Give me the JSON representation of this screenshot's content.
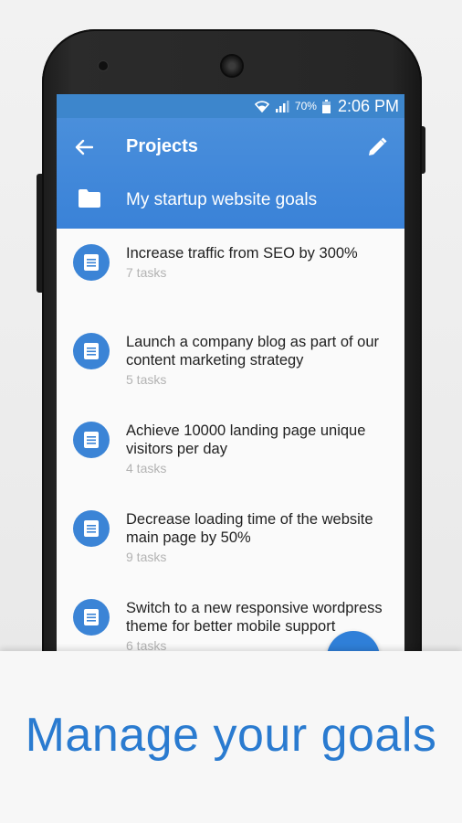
{
  "status_bar": {
    "battery": "70%",
    "time": "2:06 PM",
    "icons": [
      "wifi-icon",
      "signal-icon",
      "battery-icon"
    ]
  },
  "app_bar": {
    "title": "Projects",
    "subtitle": "My startup website goals",
    "icons": [
      "back-arrow-icon",
      "edit-pencil-icon",
      "folder-icon"
    ],
    "color": "#3a82d8"
  },
  "goals": [
    {
      "name": "Increase traffic from SEO by 300%",
      "tasks": "7 tasks"
    },
    {
      "name": "Launch a company blog as part of our content marketing strategy",
      "tasks": "5 tasks"
    },
    {
      "name": "Achieve 10000 landing page unique visitors per day",
      "tasks": "4 tasks"
    },
    {
      "name": "Decrease loading time of the website main page by 50%",
      "tasks": "9 tasks"
    },
    {
      "name": "Switch to a new responsive wordpress theme for better mobile support",
      "tasks": "6 tasks"
    }
  ],
  "caption": "Manage your goals",
  "accent_color": "#2a7bd0"
}
